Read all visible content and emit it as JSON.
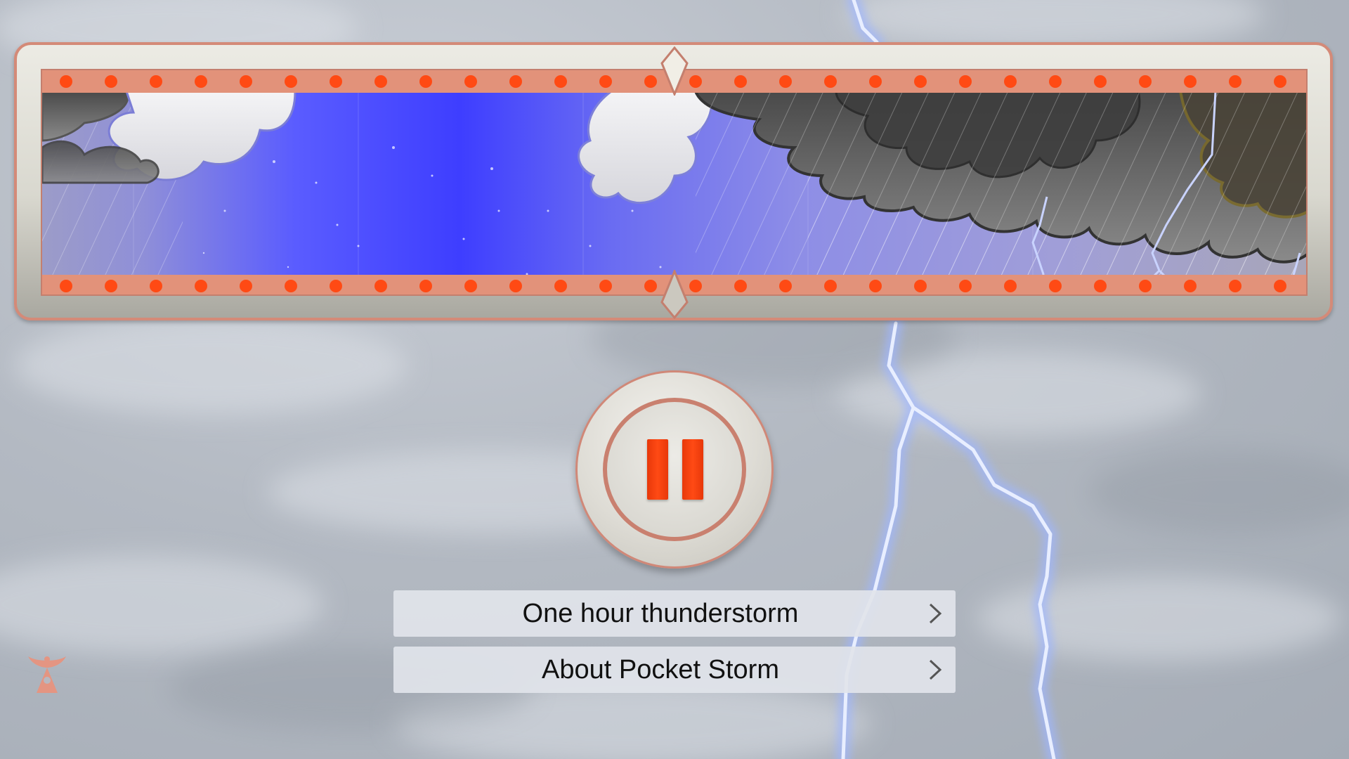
{
  "app": {
    "name": "Pocket Storm",
    "accent_color": "#ff4a14",
    "frame_color": "#d48a78"
  },
  "timeline": {
    "scene_sequence": [
      "clouds-rain",
      "night-clear",
      "night-clear",
      "clouds",
      "clouds-rain",
      "thunderstorm"
    ],
    "top_marker_icon": "diamond-marker-icon",
    "bottom_marker_icon": "diamond-marker-icon"
  },
  "player": {
    "state": "playing",
    "button_icon": "pause-icon"
  },
  "menu": {
    "items": [
      {
        "label": "One hour thunderstorm",
        "icon": "chevron-right-icon"
      },
      {
        "label": "About Pocket Storm",
        "icon": "chevron-right-icon"
      }
    ]
  },
  "brand": {
    "icon": "pocket-storm-logo-icon"
  }
}
